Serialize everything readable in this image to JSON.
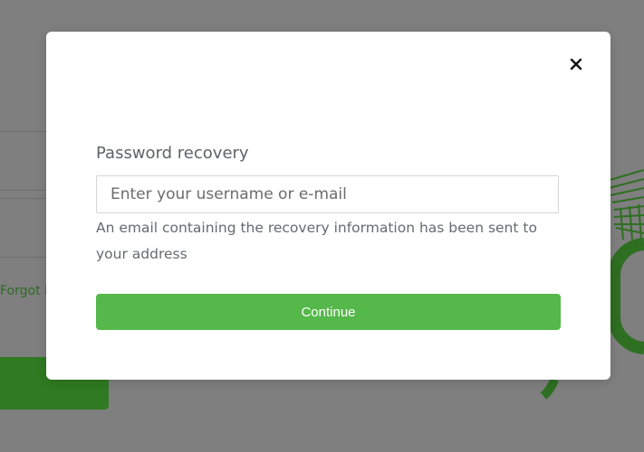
{
  "background": {
    "forgot_link": "Forgot P"
  },
  "modal": {
    "close_icon": "close-icon",
    "title": "Password recovery",
    "input_placeholder": "Enter your username or e-mail",
    "input_value": "",
    "info_text": "An email containing the recovery information has been sent to your address",
    "continue_label": "Continue"
  },
  "colors": {
    "overlay": "#7f7f7f",
    "accent": "#55b84a",
    "background_accent": "#2f7a22"
  }
}
